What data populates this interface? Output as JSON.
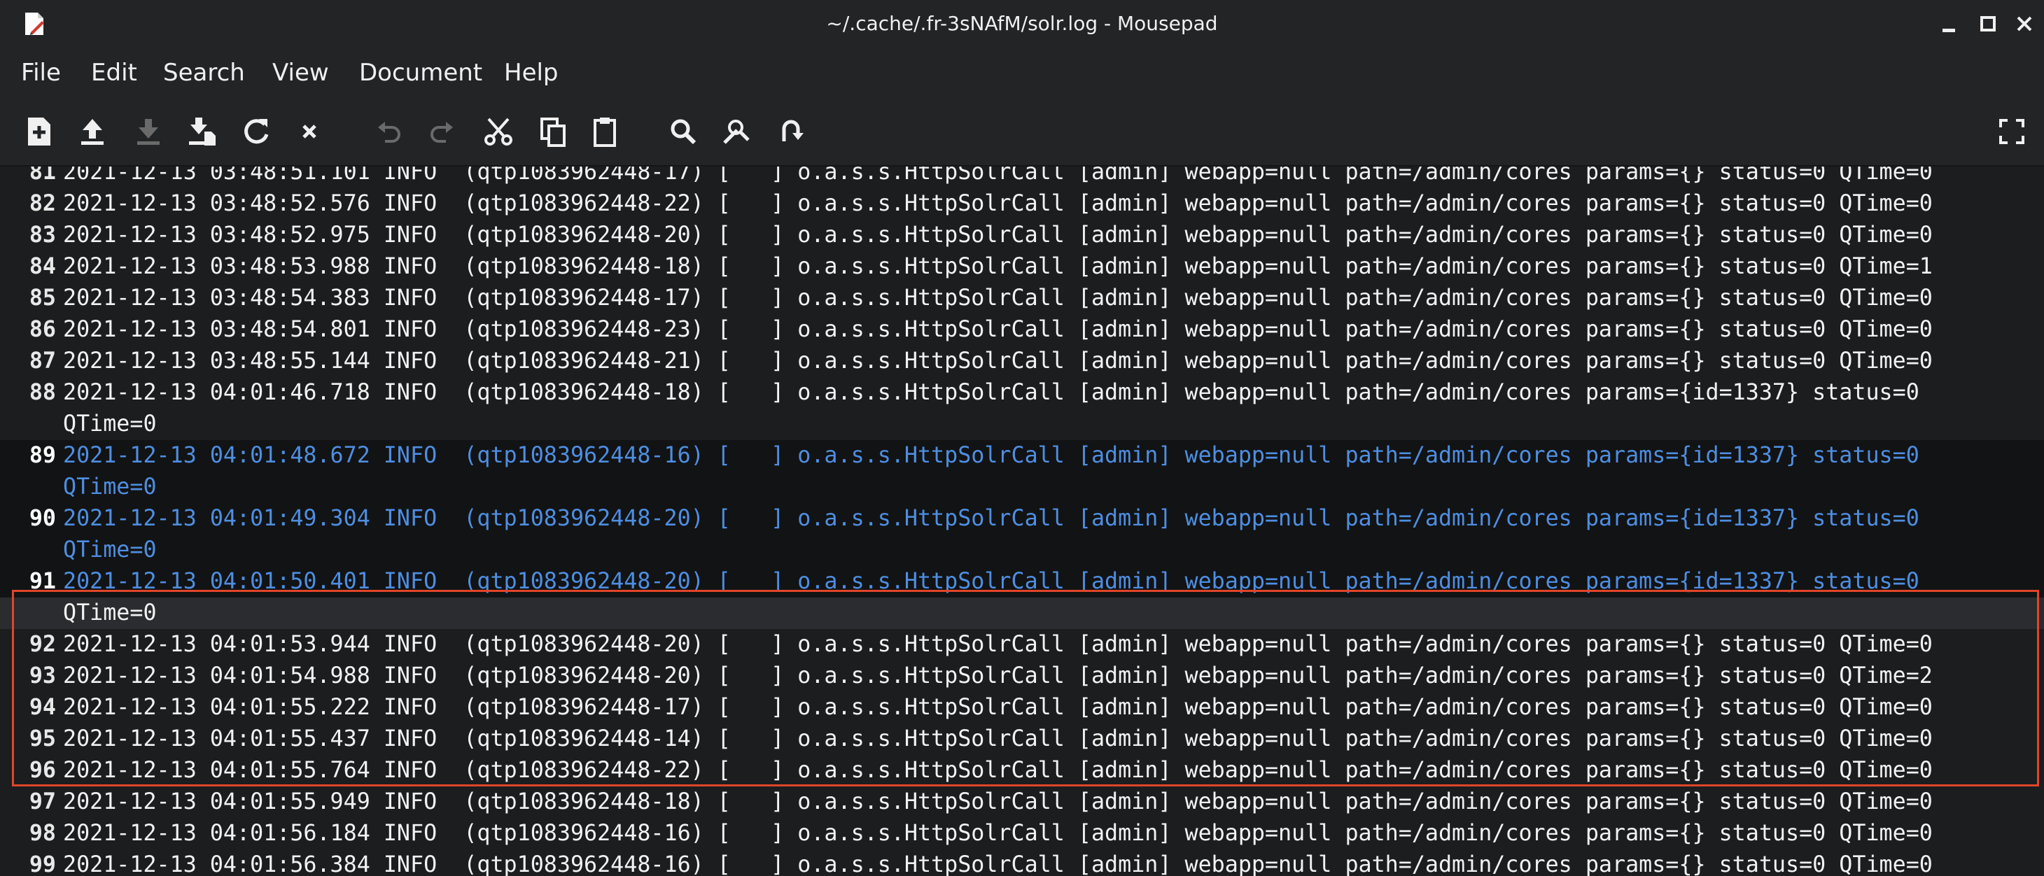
{
  "window": {
    "title": "~/.cache/.fr-3sNAfM/solr.log - Mousepad",
    "app_icon": "mousepad-icon",
    "controls": [
      "minimize-icon",
      "maximize-icon",
      "close-icon"
    ]
  },
  "menu": {
    "file": "File",
    "edit": "Edit",
    "search": "Search",
    "view": "View",
    "document": "Document",
    "help": "Help"
  },
  "toolbar": {
    "icons": [
      "new-document-icon",
      "open-icon",
      "save-icon",
      "save-as-icon",
      "reload-icon",
      "close-document-icon",
      "undo-icon",
      "redo-icon",
      "cut-icon",
      "copy-icon",
      "paste-icon",
      "find-icon",
      "find-replace-icon",
      "go-to-line-icon",
      "fullscreen-icon"
    ]
  },
  "editor": {
    "lines": [
      {
        "num": "81",
        "text": "2021-12-13 03:48:51.101 INFO  (qtp1083962448-17) [   ] o.a.s.s.HttpSolrCall [admin] webapp=null path=/admin/cores params={} status=0 QTime=0"
      },
      {
        "num": "82",
        "text": "2021-12-13 03:48:52.576 INFO  (qtp1083962448-22) [   ] o.a.s.s.HttpSolrCall [admin] webapp=null path=/admin/cores params={} status=0 QTime=0"
      },
      {
        "num": "83",
        "text": "2021-12-13 03:48:52.975 INFO  (qtp1083962448-20) [   ] o.a.s.s.HttpSolrCall [admin] webapp=null path=/admin/cores params={} status=0 QTime=0"
      },
      {
        "num": "84",
        "text": "2021-12-13 03:48:53.988 INFO  (qtp1083962448-18) [   ] o.a.s.s.HttpSolrCall [admin] webapp=null path=/admin/cores params={} status=0 QTime=1"
      },
      {
        "num": "85",
        "text": "2021-12-13 03:48:54.383 INFO  (qtp1083962448-17) [   ] o.a.s.s.HttpSolrCall [admin] webapp=null path=/admin/cores params={} status=0 QTime=0"
      },
      {
        "num": "86",
        "text": "2021-12-13 03:48:54.801 INFO  (qtp1083962448-23) [   ] o.a.s.s.HttpSolrCall [admin] webapp=null path=/admin/cores params={} status=0 QTime=0"
      },
      {
        "num": "87",
        "text": "2021-12-13 03:48:55.144 INFO  (qtp1083962448-21) [   ] o.a.s.s.HttpSolrCall [admin] webapp=null path=/admin/cores params={} status=0 QTime=0"
      },
      {
        "num": "88",
        "text": "2021-12-13 04:01:46.718 INFO  (qtp1083962448-18) [   ] o.a.s.s.HttpSolrCall [admin] webapp=null path=/admin/cores params={id=1337} status=0"
      },
      {
        "num": "",
        "text": "QTime=0"
      },
      {
        "num": "89",
        "text": "2021-12-13 04:01:48.672 INFO  (qtp1083962448-16) [   ] o.a.s.s.HttpSolrCall [admin] webapp=null path=/admin/cores params={id=1337} status=0"
      },
      {
        "num": "",
        "text": "QTime=0"
      },
      {
        "num": "90",
        "text": "2021-12-13 04:01:49.304 INFO  (qtp1083962448-20) [   ] o.a.s.s.HttpSolrCall [admin] webapp=null path=/admin/cores params={id=1337} status=0"
      },
      {
        "num": "",
        "text": "QTime=0"
      },
      {
        "num": "91",
        "text": "2021-12-13 04:01:50.401 INFO  (qtp1083962448-20) [   ] o.a.s.s.HttpSolrCall [admin] webapp=null path=/admin/cores params={id=1337} status=0"
      },
      {
        "num": "",
        "text": "QTime=0"
      },
      {
        "num": "92",
        "text": "2021-12-13 04:01:53.944 INFO  (qtp1083962448-20) [   ] o.a.s.s.HttpSolrCall [admin] webapp=null path=/admin/cores params={} status=0 QTime=0"
      },
      {
        "num": "93",
        "text": "2021-12-13 04:01:54.988 INFO  (qtp1083962448-20) [   ] o.a.s.s.HttpSolrCall [admin] webapp=null path=/admin/cores params={} status=0 QTime=2"
      },
      {
        "num": "94",
        "text": "2021-12-13 04:01:55.222 INFO  (qtp1083962448-17) [   ] o.a.s.s.HttpSolrCall [admin] webapp=null path=/admin/cores params={} status=0 QTime=0"
      },
      {
        "num": "95",
        "text": "2021-12-13 04:01:55.437 INFO  (qtp1083962448-14) [   ] o.a.s.s.HttpSolrCall [admin] webapp=null path=/admin/cores params={} status=0 QTime=0"
      },
      {
        "num": "96",
        "text": "2021-12-13 04:01:55.764 INFO  (qtp1083962448-22) [   ] o.a.s.s.HttpSolrCall [admin] webapp=null path=/admin/cores params={} status=0 QTime=0"
      },
      {
        "num": "97",
        "text": "2021-12-13 04:01:55.949 INFO  (qtp1083962448-18) [   ] o.a.s.s.HttpSolrCall [admin] webapp=null path=/admin/cores params={} status=0 QTime=0"
      },
      {
        "num": "98",
        "text": "2021-12-13 04:01:56.184 INFO  (qtp1083962448-16) [   ] o.a.s.s.HttpSolrCall [admin] webapp=null path=/admin/cores params={} status=0 QTime=0"
      },
      {
        "num": "99",
        "text": "2021-12-13 04:01:56.384 INFO  (qtp1083962448-16) [   ] o.a.s.s.HttpSolrCall [admin] webapp=null path=/admin/cores params={} status=0 QTime=0"
      }
    ]
  },
  "colors": {
    "selection_text": "#4e8ee2",
    "annotation_box": "#e0452a"
  }
}
